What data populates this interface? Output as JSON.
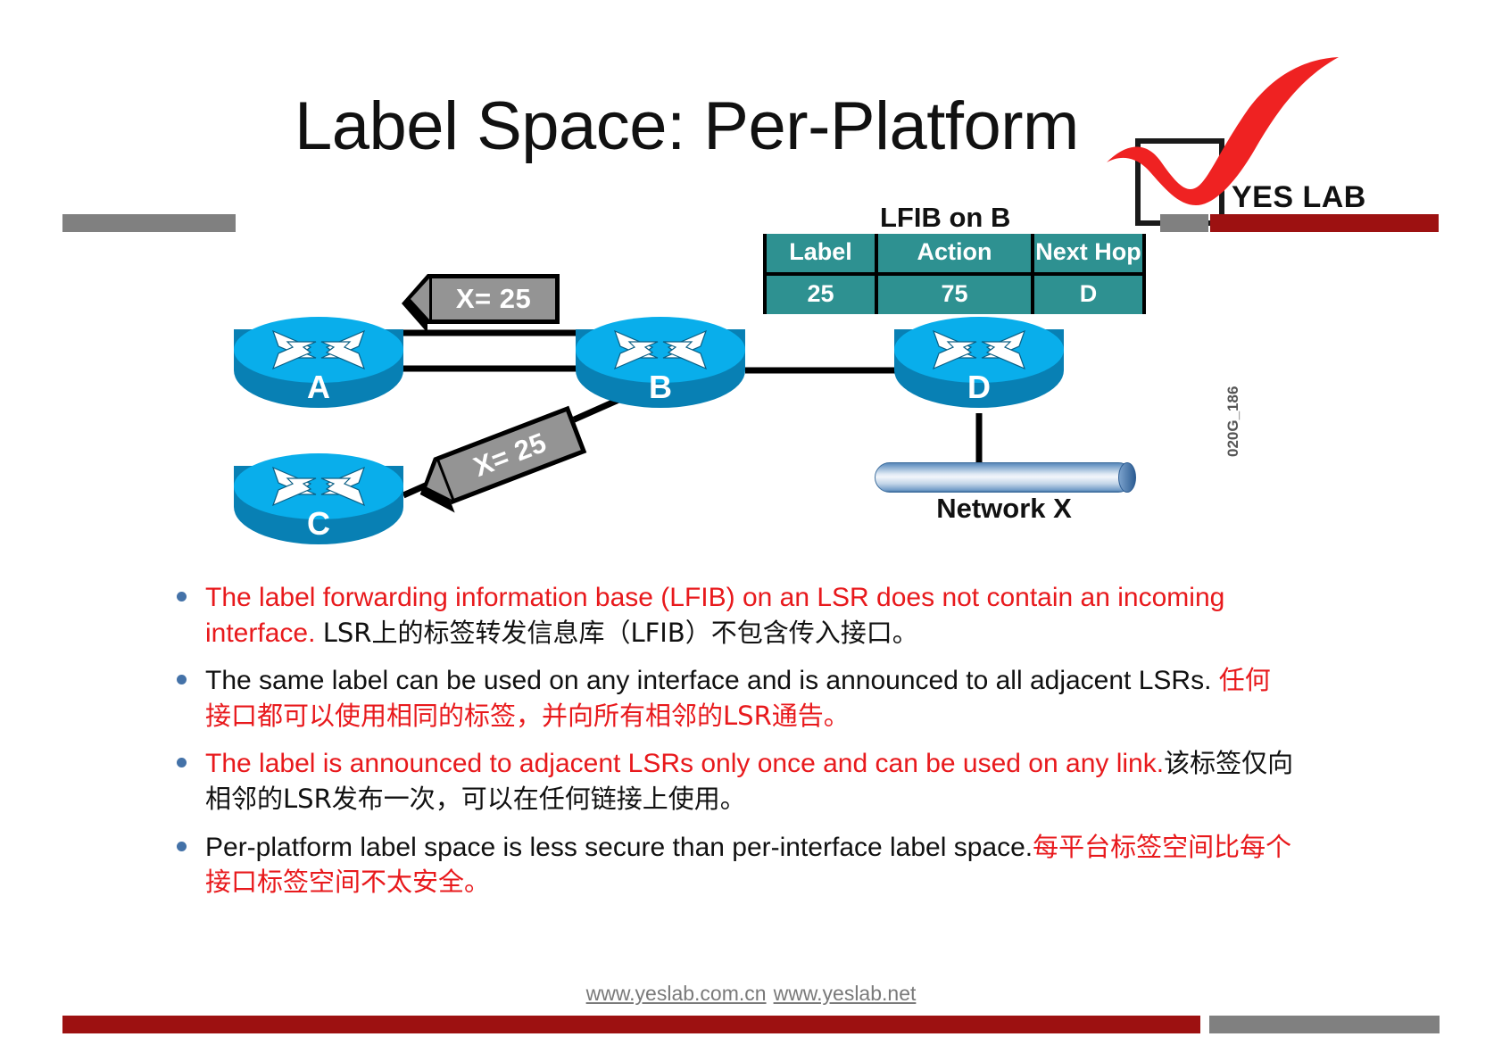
{
  "title": "Label Space: Per-Platform",
  "logo": {
    "brand": "YES LAB",
    "check_icon": "red-checkmark-icon"
  },
  "lfib": {
    "caption": "LFIB on B",
    "columns": [
      "Label",
      "Action",
      "Next Hop"
    ],
    "rows": [
      [
        "25",
        "75",
        "D"
      ]
    ],
    "header_bg": "#2e9191"
  },
  "diagram": {
    "routers": [
      {
        "id": "a",
        "label": "A"
      },
      {
        "id": "b",
        "label": "B"
      },
      {
        "id": "c",
        "label": "C"
      },
      {
        "id": "d",
        "label": "D"
      }
    ],
    "banners": [
      {
        "id": "1",
        "text": "X= 25"
      },
      {
        "id": "2",
        "text": "X= 25"
      }
    ],
    "network": {
      "label": "Network X"
    },
    "side_code": "020G_186"
  },
  "bullets": [
    {
      "parts": [
        {
          "text": "The label  forwarding information base (LFIB) on an LSR does not contain an incoming interface. ",
          "color": "red"
        },
        {
          "text": "LSR上的标签转发信息库（LFIB）不包含传入接口。",
          "color": "black"
        }
      ]
    },
    {
      "parts": [
        {
          "text": "The same label can be used on any interface and is announced to all adjacent  LSRs. ",
          "color": "black"
        },
        {
          "text": "任何接口都可以使用相同的标签，并向所有相邻的LSR通告。",
          "color": "red"
        }
      ]
    },
    {
      "parts": [
        {
          "text": "The label  is announced  to adjacent LSRs only once and can be used on any link.",
          "color": "red"
        },
        {
          "text": "该标签仅向相邻的LSR发布一次，可以在任何链接上使用。",
          "color": "black"
        }
      ]
    },
    {
      "parts": [
        {
          "text": "Per-platform label space is less  secure than per-interface label space.",
          "color": "black"
        },
        {
          "text": "每平台标签空间比每个接口标签空间不太安全。",
          "color": "red"
        }
      ]
    }
  ],
  "footer": {
    "link1": "www.yeslab.com.cn",
    "link2": "www.yeslab.net"
  },
  "colors": {
    "accent_red": "#e8191c",
    "bar_red": "#9d1111",
    "bar_grey": "#808080",
    "router_top": "#09aeeb",
    "router_body": "#0880b4",
    "table_teal": "#2e9191"
  }
}
